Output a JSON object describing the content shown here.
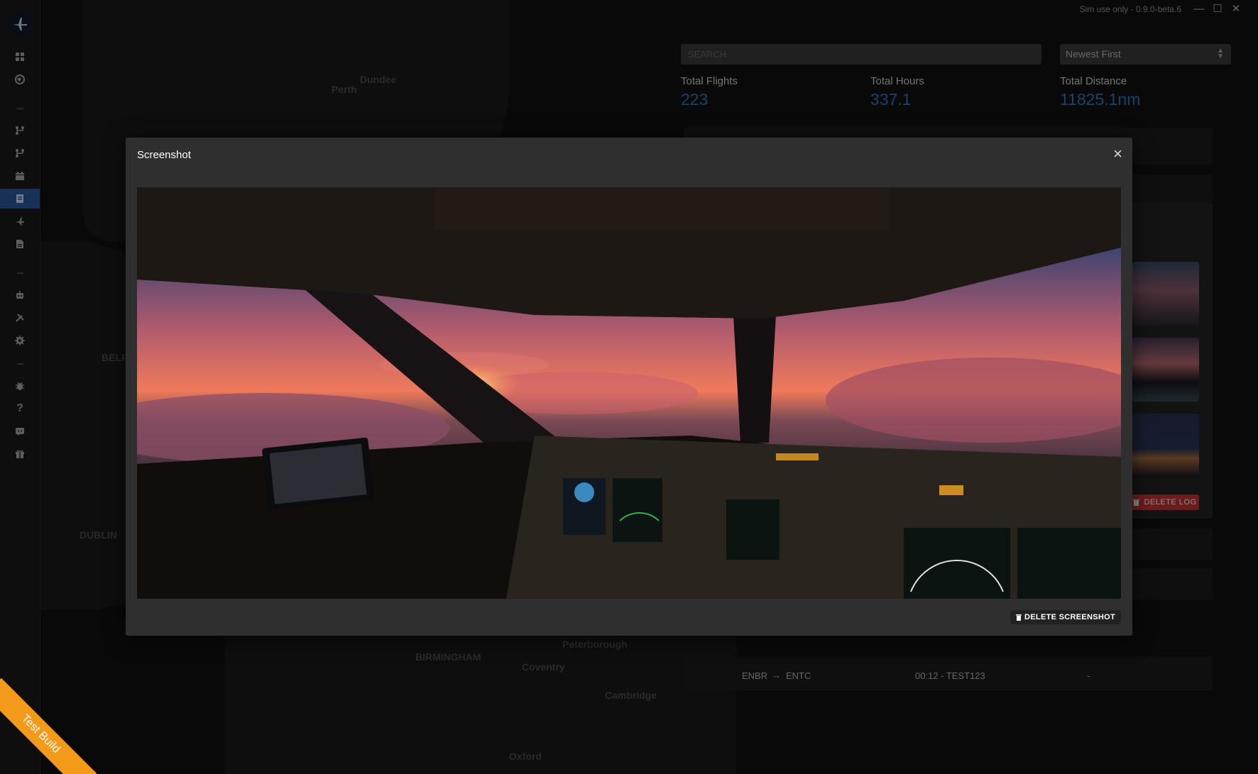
{
  "window": {
    "version": "Sim use only - 0.9.0-beta.6",
    "minimize": "—",
    "maximize": "☐",
    "close": "✕"
  },
  "sidebar": {
    "items": [
      {
        "icon": "dashboard-icon",
        "active": false
      },
      {
        "icon": "globe-icon",
        "active": false
      },
      {
        "icon": "route-icon",
        "active": false
      },
      {
        "icon": "route-alt-icon",
        "active": false
      },
      {
        "icon": "calendar-icon",
        "active": false
      },
      {
        "icon": "logbook-icon",
        "active": true
      },
      {
        "icon": "plane-icon",
        "active": false
      },
      {
        "icon": "document-icon",
        "active": false
      },
      {
        "icon": "robot-icon",
        "active": false
      },
      {
        "icon": "tools-icon",
        "active": false
      },
      {
        "icon": "settings-icon",
        "active": false
      },
      {
        "icon": "bug-icon",
        "active": false
      },
      {
        "icon": "help-icon",
        "active": false
      },
      {
        "icon": "chat-icon",
        "active": false
      },
      {
        "icon": "gift-icon",
        "active": false
      }
    ]
  },
  "map": {
    "cities": [
      "Dundee",
      "Perth",
      "BELF",
      "DUBLIN",
      "BIRMINGHAM",
      "Coventry",
      "Peterborough",
      "Cambridge",
      "Oxford"
    ]
  },
  "logbook": {
    "search_placeholder": "SEARCH",
    "sort_selected": "Newest First",
    "stats": {
      "flights_label": "Total Flights",
      "flights_value": "223",
      "hours_label": "Total Hours",
      "hours_value": "337.1",
      "distance_label": "Total Distance",
      "distance_value": "11825.1nm"
    },
    "delete_log_label": "DELETE LOG",
    "flight_row": {
      "from": "ENBR",
      "arrow": "→",
      "to": "ENTC",
      "duration_callsign": "00:12 - TEST123",
      "extra": "-"
    }
  },
  "modal": {
    "title": "Screenshot",
    "close": "×",
    "delete_label": "DELETE SCREENSHOT"
  },
  "ribbon": {
    "label": "Test Build"
  },
  "colors": {
    "accent": "#2b79c2",
    "active_nav": "#2a5aa0",
    "danger": "#c43535",
    "ribbon": "#f39a1a"
  }
}
